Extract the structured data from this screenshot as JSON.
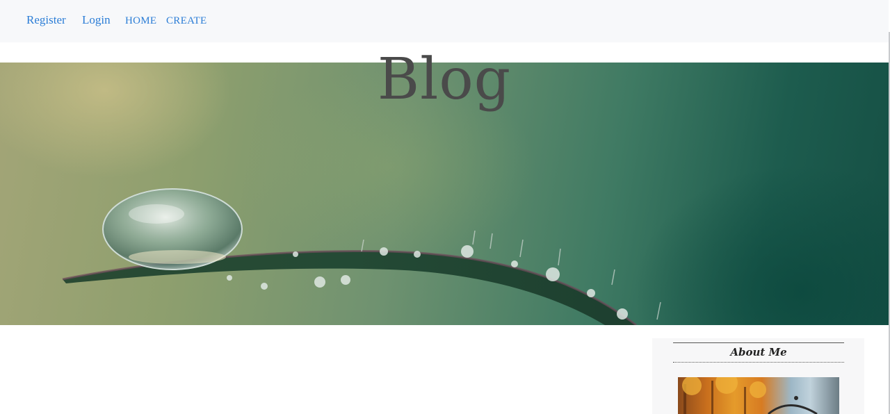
{
  "nav": {
    "register": "Register",
    "login": "Login",
    "home": "HOME",
    "create": "CREATE"
  },
  "hero": {
    "title": "Blog"
  },
  "sidebar": {
    "about_heading": "About Me"
  },
  "colors": {
    "link": "#2b7dd6",
    "navbar_bg": "#f7f8fa",
    "title": "#4a4a4a"
  }
}
